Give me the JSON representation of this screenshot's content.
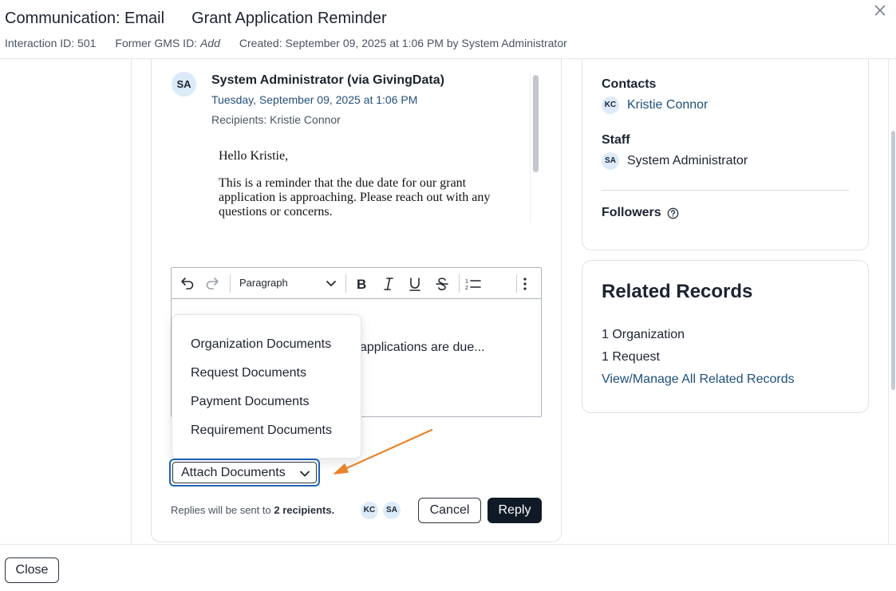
{
  "header": {
    "type_label": "Communication: Email",
    "subject": "Grant Application Reminder",
    "interaction_id": "Interaction ID: 501",
    "former_gms_label": "Former GMS ID:",
    "former_gms_value": "Add",
    "created": "Created: September 09, 2025 at 1:06 PM by System Administrator",
    "close_icon": "close-icon"
  },
  "message": {
    "avatar": "SA",
    "sender": "System Administrator (via GivingData)",
    "date": "Tuesday, September 09, 2025 at 1:06 PM",
    "recipients": "Recipients: Kristie Connor",
    "greeting": "Hello Kristie,",
    "body": "This is a reminder that the due date for our grant application is approaching. Please reach out with any questions or concerns."
  },
  "editor": {
    "paragraph_style": "Paragraph",
    "draft_text": "applications are due...",
    "toolbar_icons": [
      "undo-icon",
      "redo-icon",
      "bold-icon",
      "italic-icon",
      "underline-icon",
      "strikethrough-icon",
      "numbered-list-icon",
      "more-icon"
    ]
  },
  "attach_menu": {
    "items": [
      "Organization Documents",
      "Request Documents",
      "Payment Documents",
      "Requirement Documents"
    ]
  },
  "attach": {
    "label": "Attach Documents"
  },
  "reply_footer": {
    "prefix": "Replies will be sent to",
    "count": "2 recipients.",
    "avatars": [
      "KC",
      "SA"
    ],
    "cancel_label": "Cancel",
    "reply_label": "Reply"
  },
  "people": {
    "contacts_label": "Contacts",
    "contacts": [
      {
        "initials": "KC",
        "name": "Kristie Connor"
      }
    ],
    "staff_label": "Staff",
    "staff": [
      {
        "initials": "SA",
        "name": "System Administrator"
      }
    ],
    "followers_label": "Followers"
  },
  "related": {
    "title": "Related Records",
    "organizations": "1 Organization",
    "requests": "1 Request",
    "manage_link": "View/Manage All Related Records"
  },
  "footer": {
    "close_label": "Close"
  },
  "colors": {
    "link": "#1e4f7c",
    "avatar_bg": "#dcebf8",
    "primary_button": "#101a26",
    "focus_ring": "#1e63b8",
    "annotation_arrow": "#e8832a"
  }
}
